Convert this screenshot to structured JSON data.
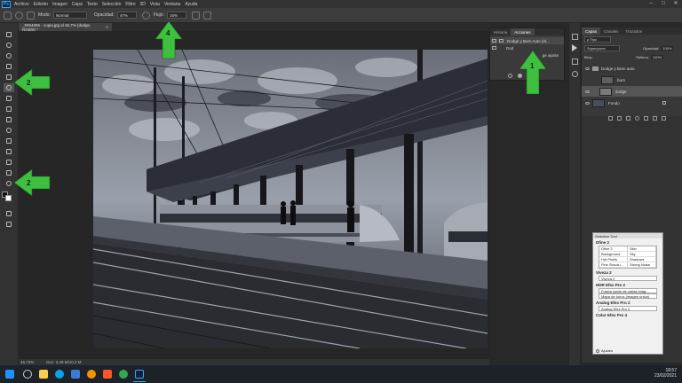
{
  "app": {
    "logo": "Ps"
  },
  "menu": {
    "items": [
      "Archivo",
      "Edición",
      "Imagen",
      "Capa",
      "Texto",
      "Selección",
      "Filtro",
      "3D",
      "Vista",
      "Ventana",
      "Ayuda"
    ]
  },
  "window_controls": {
    "minimize": "–",
    "maximize": "□",
    "close": "✕"
  },
  "options": {
    "mode_label": "Modo:",
    "mode_value": "Normal",
    "opacity_label": "Opacidad:",
    "opacity_value": "47%",
    "flow_label": "Flujo:",
    "flow_value": "15%"
  },
  "document": {
    "tab_title": "_9254695 - copia.jpg al 46,7% (dodge, RGB/8) *",
    "tab_close": "×"
  },
  "status": {
    "zoom": "46,73%",
    "doc_info": "Doc: 3,48 M/10,2 M"
  },
  "actions_panel": {
    "tabs": [
      "Historia",
      "Acciones"
    ],
    "rows": [
      "Dodge y Burn Auto (el...",
      "Dod",
      "ge ajuste"
    ]
  },
  "layers_panel": {
    "tabs": [
      "Capas",
      "Canales",
      "Trazados"
    ],
    "filter_label": "ρ Tipo",
    "blend_mode": "Superponer",
    "opacity_label": "Opacidad:",
    "opacity_value": "100%",
    "lock_label": "Bloq.:",
    "fill_label": "Relleno:",
    "fill_value": "100%",
    "layers": [
      {
        "name": "Dodge y Burn auto",
        "kind": "group"
      },
      {
        "name": "burn",
        "kind": "layer"
      },
      {
        "name": "dodge",
        "kind": "layer"
      },
      {
        "name": "Fondo",
        "kind": "layer"
      }
    ]
  },
  "selective_tool": {
    "title": "Selective Tool",
    "sections": [
      {
        "head": "Dfine 2",
        "cells": [
          [
            "Dfine 2",
            "Skin"
          ],
          [
            "Background",
            "Sky"
          ],
          [
            "Hot Pixels",
            "Shadows"
          ],
          [
            "Fine Structu...",
            "Strong Noise"
          ]
        ]
      },
      {
        "head": "Viveza 2",
        "buttons": [
          "Viveza 2"
        ]
      },
      {
        "head": "HDR Efex Pro 2",
        "buttons": [
          "Fusión (serie de varias imág...",
          "Mapa de tonos (imagen única)"
        ]
      },
      {
        "head": "Analog Efex Pro 2",
        "buttons": [
          "Analog Efex Pro 2"
        ]
      },
      {
        "head": "Color Efex Pro 4",
        "buttons": []
      }
    ],
    "footer": "Ajustes"
  },
  "annotations": [
    {
      "number": "1",
      "color": "#3fbf3f"
    },
    {
      "number": "2",
      "color": "#3fbf3f"
    },
    {
      "number": "2",
      "color": "#3fbf3f"
    },
    {
      "number": "4",
      "color": "#3fbf3f"
    }
  ],
  "taskbar": {
    "time": "18:57",
    "date": "23/02/2021",
    "icons": [
      "windows-icon",
      "search-icon",
      "taskview-icon",
      "edge-icon",
      "explorer-icon",
      "store-icon",
      "mail-icon",
      "firefox-icon",
      "brave-icon",
      "chrome-icon",
      "settings-icon",
      "photoshop-icon"
    ]
  }
}
